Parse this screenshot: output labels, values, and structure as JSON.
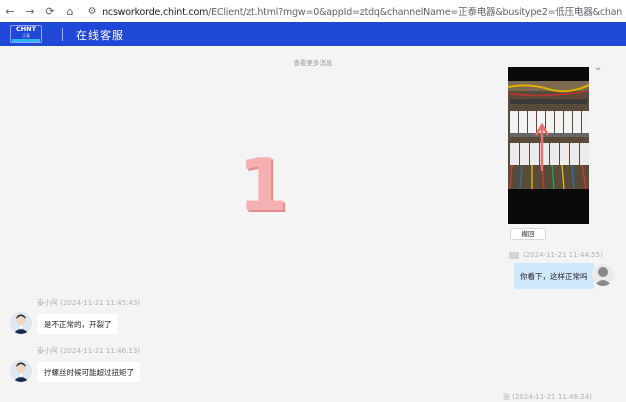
{
  "browser": {
    "back_icon": "←",
    "forward_icon": "→",
    "reload_icon": "⟳",
    "home_icon": "⌂",
    "site_info_icon": "⚙",
    "url_host": "ncsworkorde.chint.com",
    "url_rest": "/EClient/zt.html?mgw=0&appId=ztdq&channelName=正泰电器&busitype2=低压电器&channelType=webchat"
  },
  "header": {
    "logo_main": "CHNT",
    "logo_sub": "正泰",
    "title": "在线客服"
  },
  "chat": {
    "more_messages": "查看更多消息",
    "recall_label": "撤回",
    "watermark": "1",
    "messages": [
      {
        "sender": "user",
        "timestamp": "(2024-11-21 11:44:55)",
        "text": "你看下，这样正常吗"
      },
      {
        "sender": "agent",
        "name_ts": "泰小阿 (2024-11-21 11:45:43)",
        "text": "是不正常的，开裂了"
      },
      {
        "sender": "agent",
        "name_ts": "泰小阿 (2024-11-21 11:46:13)",
        "text": "拧螺丝时候可能超过扭矩了"
      },
      {
        "sender": "user",
        "timestamp": "张 (2024-11-21 11:46:24)"
      }
    ]
  },
  "colors": {
    "header_bg": "#1f47d8",
    "user_bubble": "#cfe8fb",
    "agent_bubble": "#ffffff",
    "chat_bg": "#f4f4f4"
  }
}
